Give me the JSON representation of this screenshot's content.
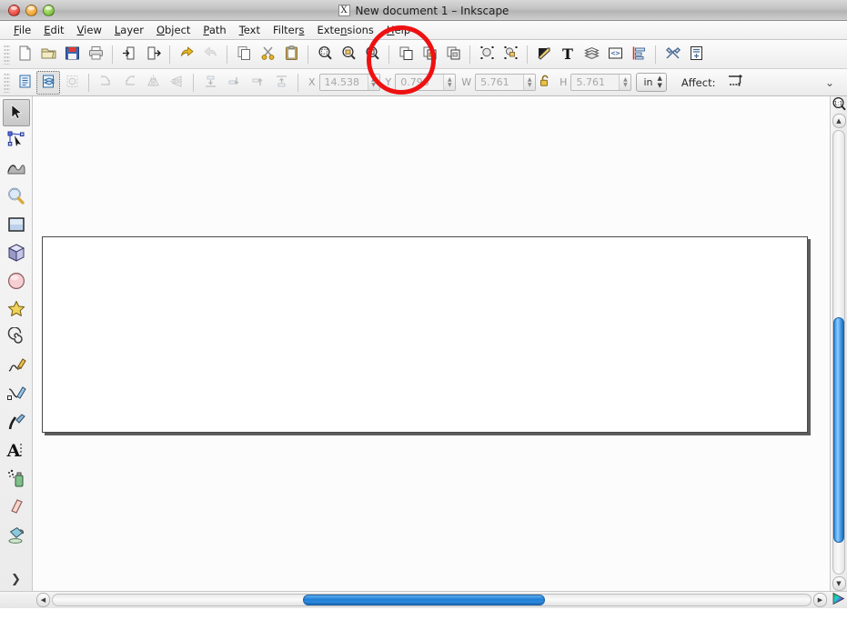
{
  "window": {
    "title": "New document 1 – Inkscape",
    "app_icon": "X",
    "controls": [
      "close",
      "minimize",
      "maximize"
    ]
  },
  "menubar": {
    "items": [
      {
        "label": "File",
        "mnemonic": "F"
      },
      {
        "label": "Edit",
        "mnemonic": "E"
      },
      {
        "label": "View",
        "mnemonic": "V"
      },
      {
        "label": "Layer",
        "mnemonic": "L"
      },
      {
        "label": "Object",
        "mnemonic": "O"
      },
      {
        "label": "Path",
        "mnemonic": "P"
      },
      {
        "label": "Text",
        "mnemonic": "T"
      },
      {
        "label": "Filters",
        "mnemonic": "s"
      },
      {
        "label": "Extensions",
        "mnemonic": "n"
      },
      {
        "label": "Help",
        "mnemonic": "H"
      }
    ]
  },
  "command_toolbar": {
    "buttons": [
      {
        "name": "new-document",
        "icon": "new-document-icon",
        "enabled": true
      },
      {
        "name": "open-document",
        "icon": "open-folder-icon",
        "enabled": true
      },
      {
        "name": "save-document",
        "icon": "save-floppy-icon",
        "enabled": true
      },
      {
        "name": "print-document",
        "icon": "printer-icon",
        "enabled": true
      },
      {
        "name": "import",
        "icon": "import-icon",
        "enabled": true
      },
      {
        "name": "export",
        "icon": "export-icon",
        "enabled": true
      },
      {
        "name": "undo",
        "icon": "undo-arrow-icon",
        "enabled": true
      },
      {
        "name": "redo",
        "icon": "redo-arrow-icon",
        "enabled": false
      },
      {
        "name": "copy",
        "icon": "copy-icon",
        "enabled": true
      },
      {
        "name": "cut",
        "icon": "scissors-icon",
        "enabled": true
      },
      {
        "name": "paste",
        "icon": "clipboard-icon",
        "enabled": true
      },
      {
        "name": "zoom-selection",
        "icon": "zoom-selection-icon",
        "enabled": true
      },
      {
        "name": "zoom-drawing",
        "icon": "zoom-drawing-icon",
        "enabled": true
      },
      {
        "name": "zoom-page",
        "icon": "zoom-page-icon",
        "enabled": true
      },
      {
        "name": "duplicate",
        "icon": "duplicate-icon",
        "enabled": true
      },
      {
        "name": "clone",
        "icon": "clone-icon",
        "enabled": true
      },
      {
        "name": "unlink-clone",
        "icon": "unlink-clone-icon",
        "enabled": true
      },
      {
        "name": "group",
        "icon": "group-icon",
        "enabled": true
      },
      {
        "name": "ungroup",
        "icon": "ungroup-icon",
        "enabled": true
      },
      {
        "name": "fill-and-stroke",
        "icon": "fill-stroke-pen-icon",
        "enabled": true
      },
      {
        "name": "text-and-font",
        "icon": "text-T-icon",
        "enabled": true
      },
      {
        "name": "layers",
        "icon": "layers-stack-icon",
        "enabled": true
      },
      {
        "name": "xml-editor",
        "icon": "xml-editor-icon",
        "enabled": true
      },
      {
        "name": "align-and-distribute",
        "icon": "align-distribute-icon",
        "enabled": true
      },
      {
        "name": "preferences",
        "icon": "tools-wrench-icon",
        "enabled": true
      },
      {
        "name": "document-properties",
        "icon": "document-properties-icon",
        "enabled": true
      }
    ]
  },
  "tool_options_bar": {
    "buttons": [
      {
        "name": "select-all",
        "icon": "select-all-icon",
        "enabled": true,
        "pressed": false
      },
      {
        "name": "select-all-in-all-layers",
        "icon": "select-all-layers-icon",
        "enabled": true,
        "pressed": true
      },
      {
        "name": "deselect",
        "icon": "deselect-icon",
        "enabled": false,
        "pressed": false
      },
      {
        "name": "rotate-counter-clockwise",
        "icon": "rotate-ccw-icon",
        "enabled": false
      },
      {
        "name": "rotate-clockwise",
        "icon": "rotate-cw-icon",
        "enabled": false
      },
      {
        "name": "flip-horizontal",
        "icon": "flip-horizontal-icon",
        "enabled": false
      },
      {
        "name": "flip-vertical",
        "icon": "flip-vertical-icon",
        "enabled": false
      },
      {
        "name": "lower-to-bottom",
        "icon": "lower-to-bottom-icon",
        "enabled": false
      },
      {
        "name": "lower-one-step",
        "icon": "lower-step-icon",
        "enabled": false
      },
      {
        "name": "raise-one-step",
        "icon": "raise-step-icon",
        "enabled": false
      },
      {
        "name": "raise-to-top",
        "icon": "raise-to-top-icon",
        "enabled": false
      }
    ],
    "fields": [
      {
        "name": "x",
        "label": "X",
        "value": "14.538"
      },
      {
        "name": "y",
        "label": "Y",
        "value": "0.798"
      },
      {
        "name": "w",
        "label": "W",
        "value": "5.761"
      },
      {
        "name": "h",
        "label": "H",
        "value": "5.761"
      }
    ],
    "lock_ratio_icon": "padlock-open-icon",
    "units": {
      "name": "units-select",
      "value": "in"
    },
    "affect": {
      "label": "Affect:",
      "icon": "affect-transform-icon"
    },
    "overflow_chevron": "chevron-down-icon"
  },
  "tool_palette": {
    "tools": [
      {
        "name": "selector-tool",
        "icon": "arrow-cursor-icon",
        "active": true
      },
      {
        "name": "node-editor-tool",
        "icon": "node-edit-icon",
        "active": false
      },
      {
        "name": "tweak-tool",
        "icon": "tweak-wave-icon",
        "active": false
      },
      {
        "name": "zoom-tool",
        "icon": "magnifier-icon",
        "active": false
      },
      {
        "name": "rectangle-tool",
        "icon": "rectangle-icon",
        "active": false
      },
      {
        "name": "box-3d-tool",
        "icon": "cube-3d-icon",
        "active": false
      },
      {
        "name": "ellipse-tool",
        "icon": "ellipse-icon",
        "active": false
      },
      {
        "name": "star-tool",
        "icon": "star-icon",
        "active": false
      },
      {
        "name": "spiral-tool",
        "icon": "spiral-icon",
        "active": false
      },
      {
        "name": "pencil-tool",
        "icon": "pencil-freehand-icon",
        "active": false
      },
      {
        "name": "bezier-tool",
        "icon": "bezier-pen-icon",
        "active": false
      },
      {
        "name": "calligraphy-tool",
        "icon": "calligraphy-pen-icon",
        "active": false
      },
      {
        "name": "text-tool",
        "icon": "text-A-icon",
        "active": false
      },
      {
        "name": "spray-tool",
        "icon": "spray-can-icon",
        "active": false
      },
      {
        "name": "eraser-tool",
        "icon": "eraser-icon",
        "active": false
      },
      {
        "name": "paint-bucket-tool",
        "icon": "paint-bucket-icon",
        "active": false
      }
    ],
    "expander_icon": "chevron-right-icon"
  },
  "canvas": {
    "page_label": "document-page",
    "zoom_indicator_icon": "zoom-1-to-1-icon",
    "color_wheel_icon": "color-wheel-icon",
    "vscroll_up_icon": "triangle-up-icon",
    "vscroll_down_icon": "triangle-down-icon",
    "hscroll_left_icon": "triangle-left-icon",
    "hscroll_right_icon": "triangle-right-icon"
  },
  "annotation": {
    "name": "red-highlight-circle",
    "color": "#ee1111",
    "target": "zoom toolbar buttons"
  },
  "colors": {
    "titlebar_grey": "#c2c2c2",
    "toolbar_grey": "#ededed",
    "canvas_white": "#fcfcfc",
    "scrollbar_blue": "#1f7ed4",
    "annotation_red": "#ee1111"
  }
}
